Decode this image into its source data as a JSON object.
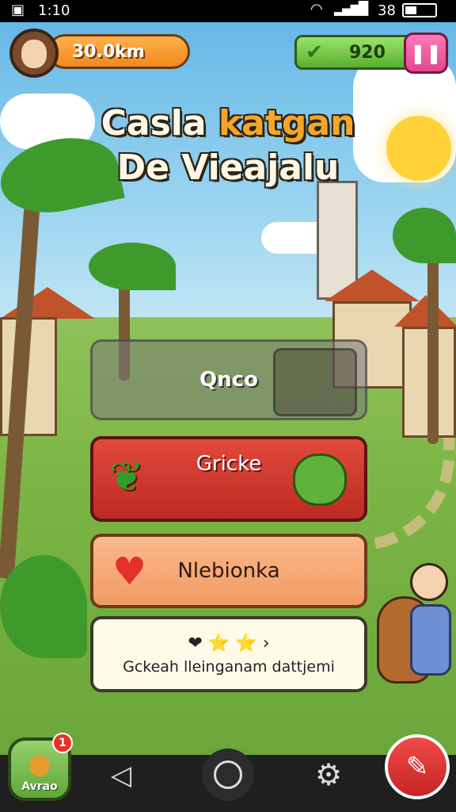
{
  "status_bar": {
    "time": "1:10",
    "battery_text": "38"
  },
  "hud": {
    "distance": "30.0km",
    "score": "920",
    "pause_icon": "pause-icon",
    "check_icon": "check-icon"
  },
  "title": {
    "line1_a": "Casla",
    "line1_b": "katgan",
    "line2": "De Vieajalu"
  },
  "menu": {
    "once_label": "Qnco",
    "green_label": "Gricke",
    "heart_label": "Nlebionka",
    "rate_label": "Gckeah lleinganam dattjemi",
    "rate_icons": "❤ ⭐ ⭐ ›"
  },
  "bottom_bar": {
    "bag_label": "Avrao",
    "bag_badge": "1",
    "back_icon": "back-triangle-icon",
    "home_icon": "home-circle-icon",
    "settings_icon": "gear-icon",
    "notes_icon": "notes-icon"
  },
  "colors": {
    "accent_orange": "#f4a62a",
    "red_button": "#e14a3c",
    "peach_button": "#fbb98a",
    "green_pill": "#58b02e",
    "pink_pause": "#e2478f"
  }
}
